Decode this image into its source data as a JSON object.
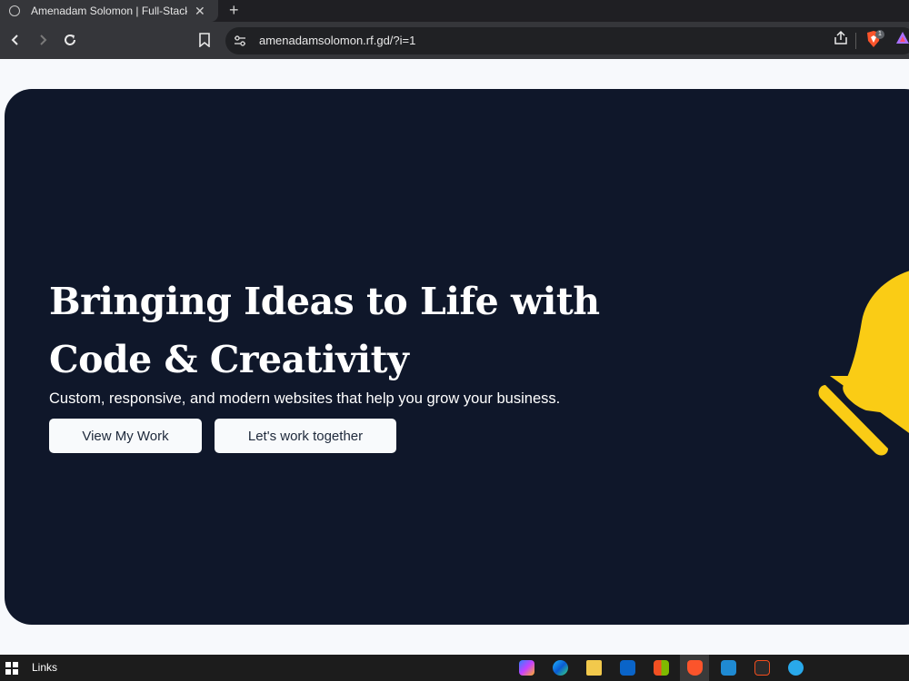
{
  "browser": {
    "tab_title": "Amenadam Solomon | Full-Stack",
    "new_tab_label": "+",
    "close_label": "✕",
    "url": "amenadamsolomon.rf.gd/?i=1",
    "brave_badge_count": "1"
  },
  "hero": {
    "headline": "Bringing Ideas to Life with Code & Creativity",
    "subheadline": "Custom, responsive, and modern websites that help you grow your business.",
    "primary_button": "View My Work",
    "secondary_button": "Let's work together"
  },
  "taskbar": {
    "links_label": "Links",
    "apps": [
      "copilot-icon",
      "edge-icon",
      "file-explorer-icon",
      "outlook-icon",
      "store-icon",
      "brave-icon",
      "vscode-icon",
      "figma-icon",
      "telegram-icon"
    ]
  },
  "colors": {
    "hero_bg": "#0f172a",
    "page_bg": "#f7f9fc",
    "bulb": "#facc15",
    "button_bg": "#f8fafc"
  }
}
